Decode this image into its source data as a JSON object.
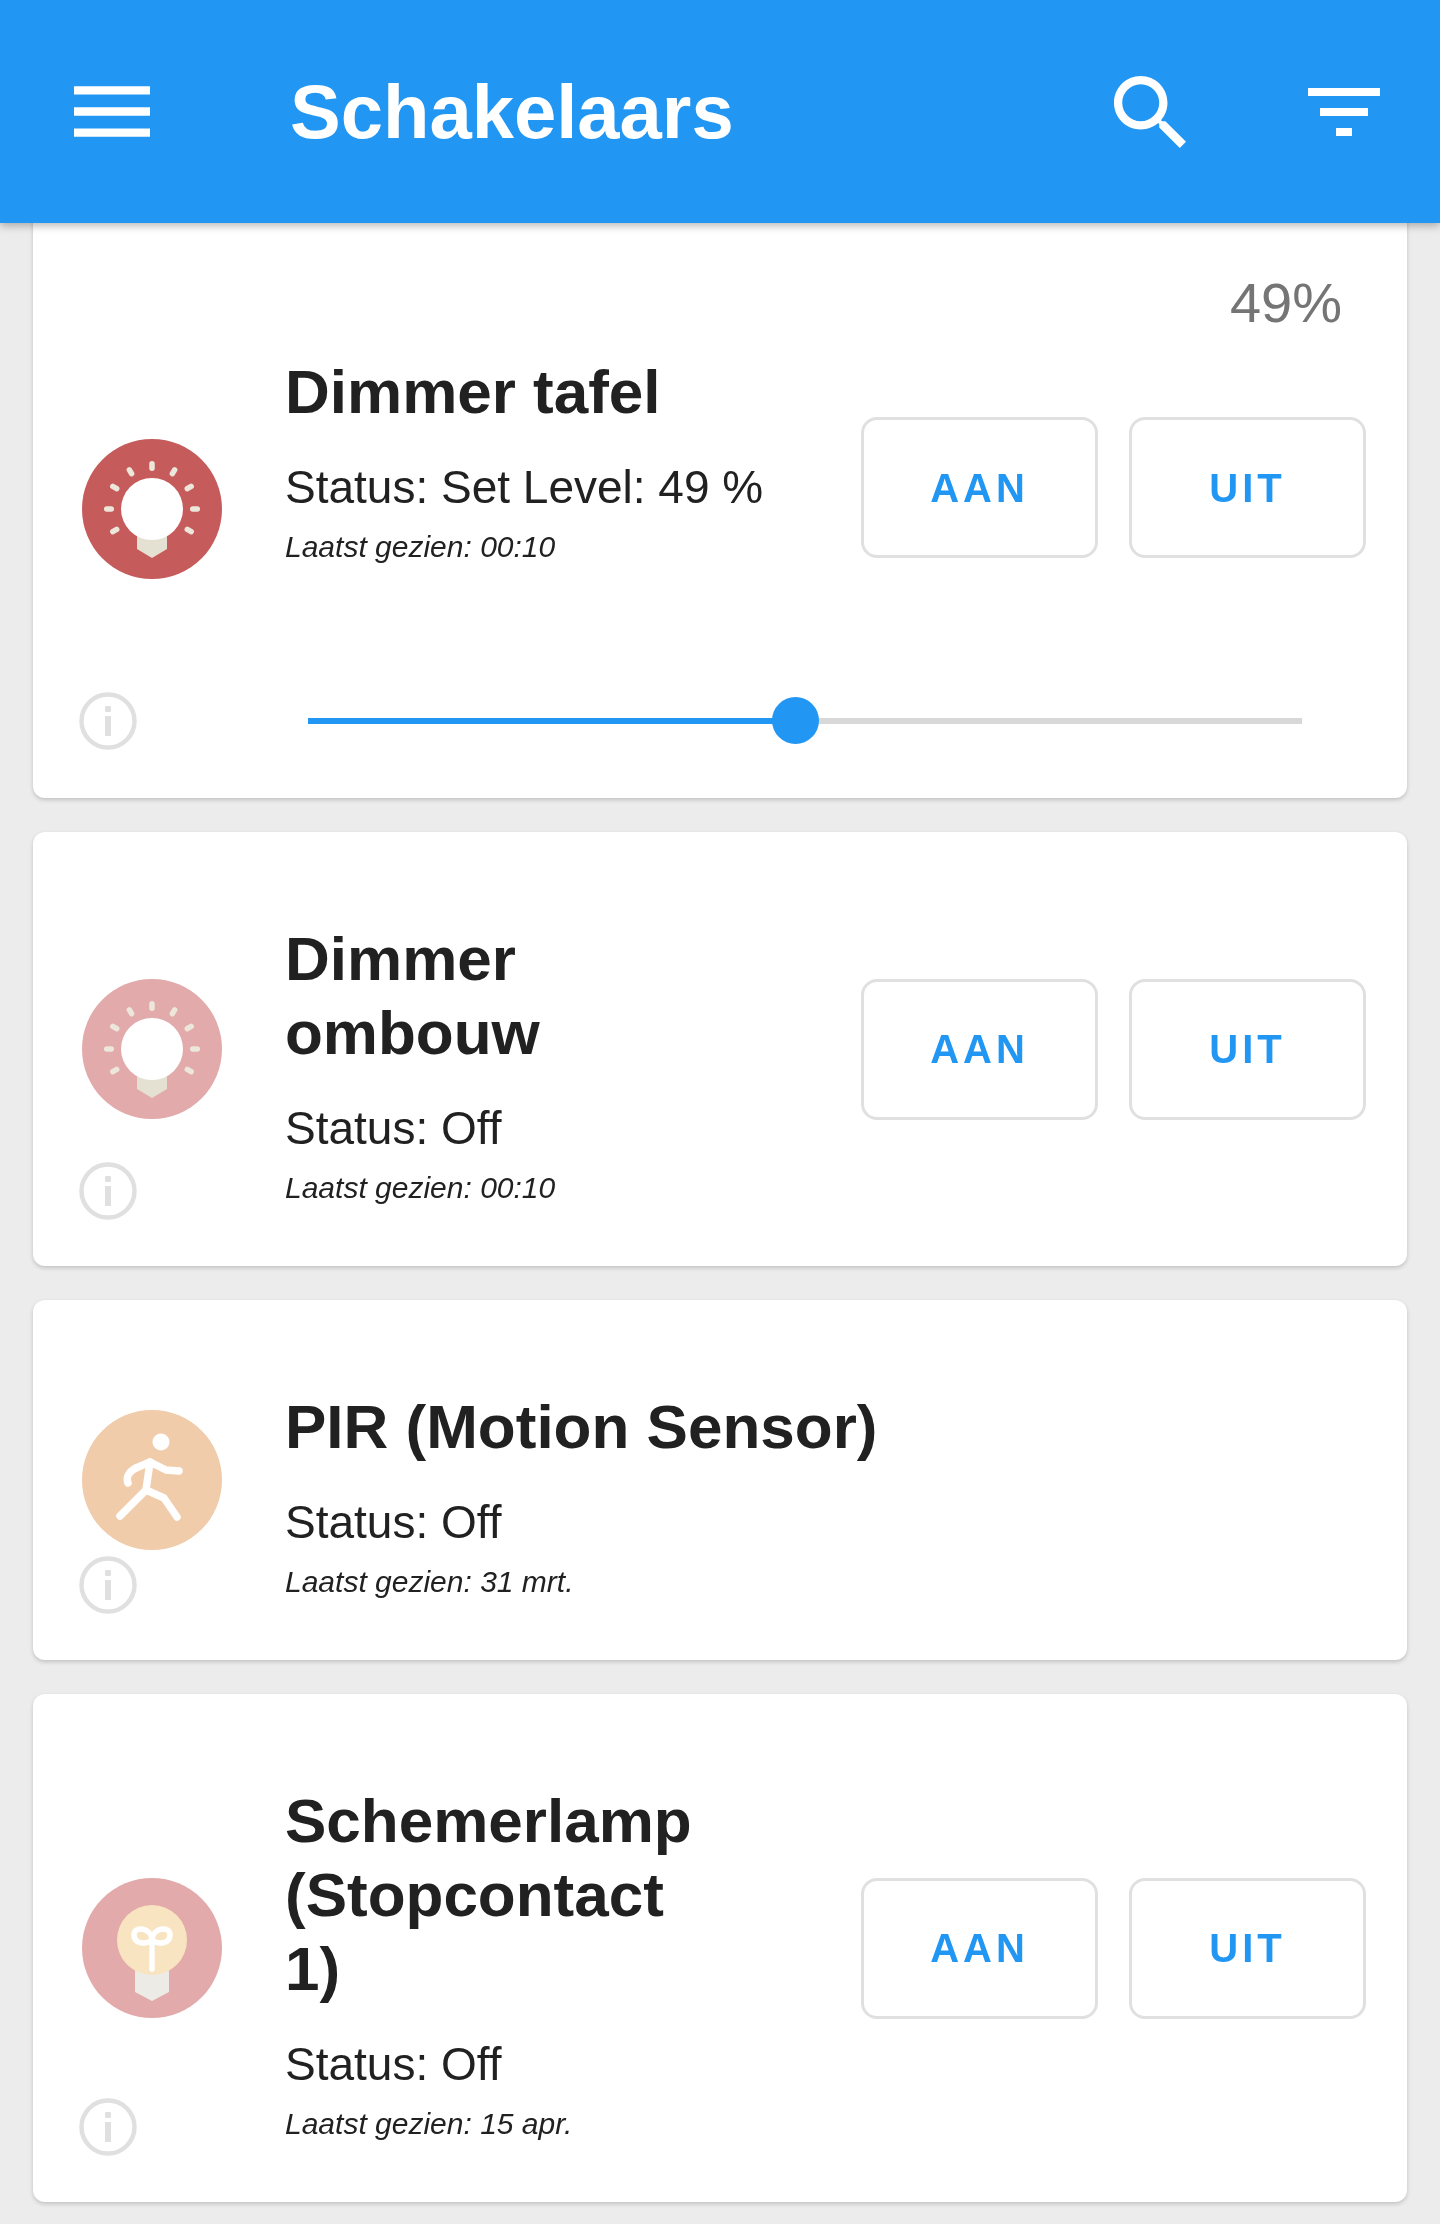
{
  "app_bar": {
    "title": "Schakelaars"
  },
  "devices": [
    {
      "kind": "dimmer",
      "name": "Dimmer tafel",
      "status": "Status: Set Level: 49 %",
      "last_seen": "Laatst gezien: 00:10",
      "color": "#c55b5b",
      "level_label": "49%",
      "level": 0.49,
      "buttons": [
        "AAN",
        "UIT"
      ]
    },
    {
      "kind": "dimmer",
      "name": "Dimmer ombouw",
      "status": "Status: Off",
      "last_seen": "Laatst gezien: 00:10",
      "color": "#e2aaaa",
      "buttons": [
        "AAN",
        "UIT"
      ]
    },
    {
      "kind": "sensor",
      "name": "PIR (Motion Sensor)",
      "status": "Status: Off",
      "last_seen": "Laatst gezien: 31 mrt.",
      "color": "#f0ccab"
    },
    {
      "kind": "switch",
      "name": "Schemerlamp (Stopcontact 1)",
      "status": "Status: Off",
      "last_seen": "Laatst gezien: 15 apr.",
      "color": "#e2aaaa",
      "buttons": [
        "AAN",
        "UIT"
      ]
    }
  ]
}
